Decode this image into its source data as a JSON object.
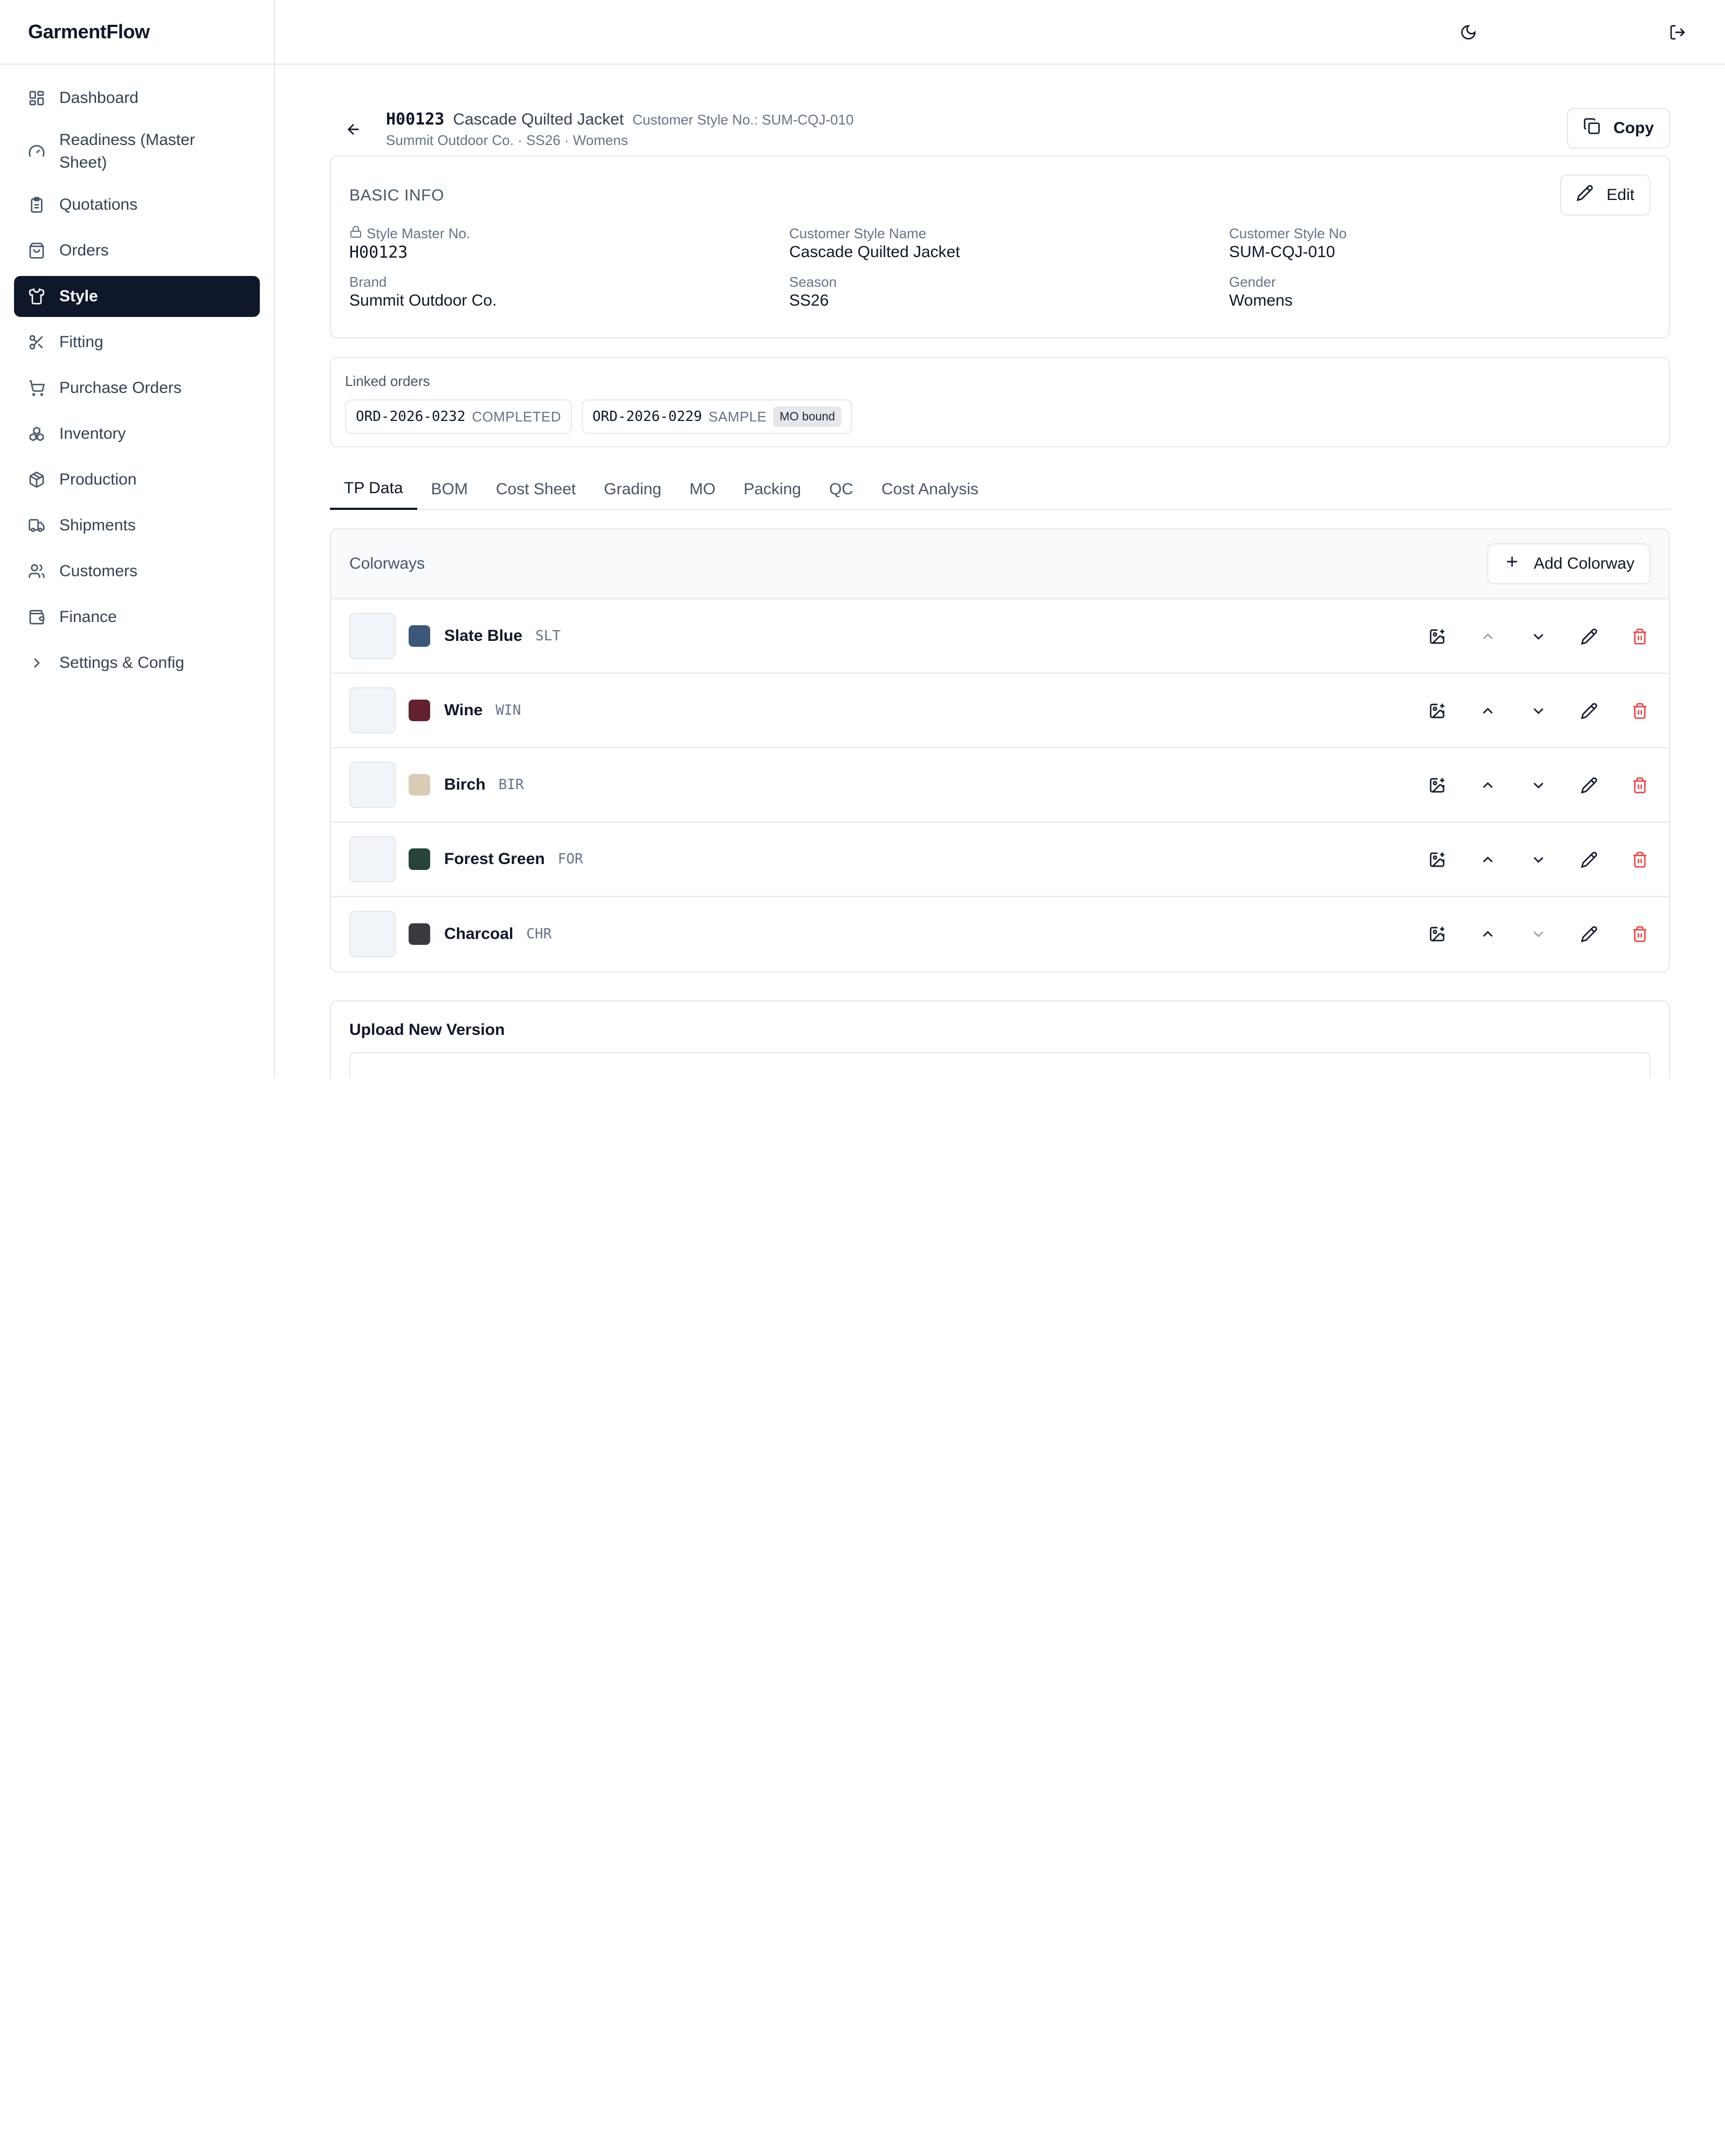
{
  "app": {
    "brand": "GarmentFlow"
  },
  "sidebar": {
    "items": [
      {
        "label": "Dashboard",
        "icon": "dashboard-icon"
      },
      {
        "label": "Readiness (Master Sheet)",
        "icon": "gauge-icon"
      },
      {
        "label": "Quotations",
        "icon": "clipboard-icon"
      },
      {
        "label": "Orders",
        "icon": "shopping-bag-icon"
      },
      {
        "label": "Style",
        "icon": "shirt-icon",
        "active": true
      },
      {
        "label": "Fitting",
        "icon": "scissors-icon"
      },
      {
        "label": "Purchase Orders",
        "icon": "cart-icon"
      },
      {
        "label": "Inventory",
        "icon": "boxes-icon"
      },
      {
        "label": "Production",
        "icon": "package-icon"
      },
      {
        "label": "Shipments",
        "icon": "truck-icon"
      },
      {
        "label": "Customers",
        "icon": "users-icon"
      },
      {
        "label": "Finance",
        "icon": "wallet-icon"
      },
      {
        "label": "Settings & Config",
        "icon": "chevron-right-icon"
      }
    ]
  },
  "topbar": {
    "theme_icon": "moon-icon",
    "logout_icon": "logout-icon"
  },
  "header": {
    "code": "H00123",
    "style_name": "Cascade Quilted Jacket",
    "customer_style": "Customer Style No.: SUM-CQJ-010",
    "subline": "Summit Outdoor Co. · SS26 · Womens",
    "copy_label": "Copy"
  },
  "basic_info": {
    "title": "BASIC INFO",
    "edit_label": "Edit",
    "fields": [
      {
        "label": "Style Master No.",
        "value": "H00123",
        "locked": true,
        "mono": true
      },
      {
        "label": "Customer Style Name",
        "value": "Cascade Quilted Jacket"
      },
      {
        "label": "Customer Style No",
        "value": "SUM-CQJ-010"
      },
      {
        "label": "Brand",
        "value": "Summit Outdoor Co."
      },
      {
        "label": "Season",
        "value": "SS26"
      },
      {
        "label": "Gender",
        "value": "Womens"
      }
    ]
  },
  "linked_orders": {
    "title": "Linked orders",
    "orders": [
      {
        "id": "ORD-2026-0232",
        "status": "COMPLETED",
        "badge": ""
      },
      {
        "id": "ORD-2026-0229",
        "status": "SAMPLE",
        "badge": "MO bound"
      }
    ]
  },
  "tabs": [
    "TP Data",
    "BOM",
    "Cost Sheet",
    "Grading",
    "MO",
    "Packing",
    "QC",
    "Cost Analysis"
  ],
  "active_tab": "TP Data",
  "colorways": {
    "title": "Colorways",
    "add_label": "Add Colorway",
    "rows": [
      {
        "name": "Slate Blue",
        "code": "SLT",
        "color": "#3b5878",
        "up_disabled": true,
        "down_disabled": false
      },
      {
        "name": "Wine",
        "code": "WIN",
        "color": "#63212f",
        "up_disabled": false,
        "down_disabled": false
      },
      {
        "name": "Birch",
        "code": "BIR",
        "color": "#d9ccb4",
        "up_disabled": false,
        "down_disabled": false
      },
      {
        "name": "Forest Green",
        "code": "FOR",
        "color": "#27443a",
        "up_disabled": false,
        "down_disabled": false
      },
      {
        "name": "Charcoal",
        "code": "CHR",
        "color": "#383a3f",
        "up_disabled": false,
        "down_disabled": true
      }
    ]
  },
  "upload": {
    "title": "Upload New Version"
  },
  "colors": {
    "accent": "#0f172a",
    "danger": "#ef4444",
    "border": "#e5e7eb",
    "muted": "#64748b"
  }
}
